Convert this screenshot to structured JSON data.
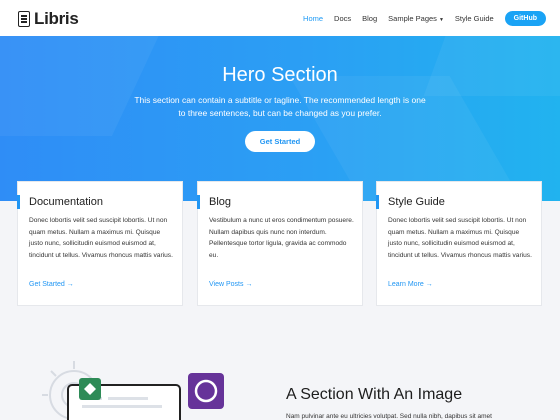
{
  "brand": {
    "name": "Libris"
  },
  "nav": {
    "home": "Home",
    "docs": "Docs",
    "blog": "Blog",
    "sample_pages": "Sample Pages",
    "style_guide": "Style Guide",
    "github": "GitHub"
  },
  "hero": {
    "title": "Hero Section",
    "subtitle": "This section can contain a subtitle or tagline. The recommended length is one to three sentences, but can be changed as you prefer.",
    "button": "Get Started"
  },
  "cards": [
    {
      "title": "Documentation",
      "body": "Donec lobortis velit sed suscipit lobortis. Ut non quam metus. Nullam a maximus mi. Quisque justo nunc, sollicitudin euismod euismod at, tincidunt ut tellus. Vivamus rhoncus mattis varius.",
      "link": "Get Started"
    },
    {
      "title": "Blog",
      "body": "Vestibulum a nunc ut eros condimentum posuere. Nullam dapibus quis nunc non interdum. Pellentesque tortor ligula, gravida ac commodo eu.",
      "link": "View Posts"
    },
    {
      "title": "Style Guide",
      "body": "Donec lobortis velit sed suscipit lobortis. Ut non quam metus. Nullam a maximus mi. Quisque justo nunc, sollicitudin euismod euismod at, tincidunt ut tellus. Vivamus rhoncus mattis varius.",
      "link": "Learn More"
    }
  ],
  "image_section": {
    "title": "A Section With An Image",
    "text": "Nam pulvinar ante eu ultricies volutpat. Sed nulla nibh, dapibus sit amet"
  },
  "colors": {
    "accent": "#2196f3",
    "hero_start": "#2f8df6",
    "hero_end": "#21b3ef",
    "badge_green": "#2e8b57",
    "badge_purple": "#663399"
  }
}
